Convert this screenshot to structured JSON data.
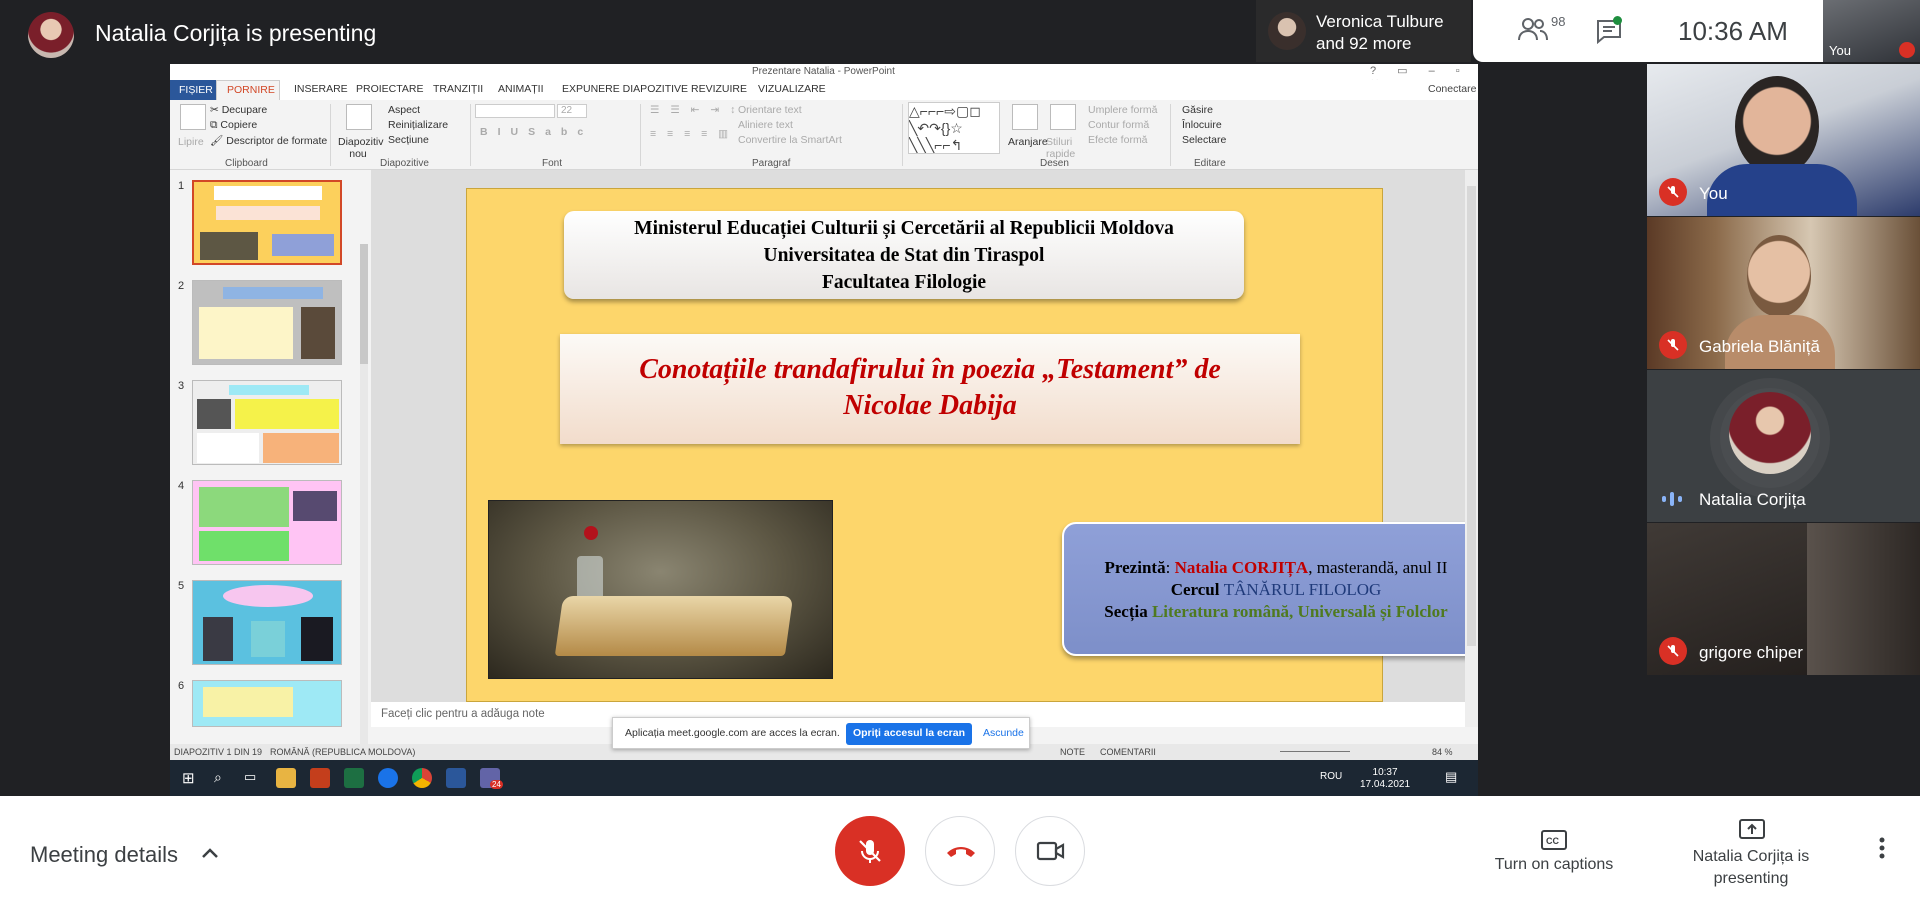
{
  "meet": {
    "presenting_title": "Natalia Corjița is presenting",
    "viewers": "Veronica Tulbure and 92 more",
    "participant_count": "98",
    "clock": "10:36  AM",
    "self_thumb_label": "You",
    "bottom": {
      "meeting_details": "Meeting details",
      "captions": "Turn on captions",
      "presenting": "Natalia Corjița is presenting"
    },
    "tiles": [
      {
        "name": "You",
        "muted": true
      },
      {
        "name": "Gabriela Blăniță",
        "muted": true
      },
      {
        "name": "Natalia Corjița",
        "muted": false,
        "speaking": true
      },
      {
        "name": "grigore chiper",
        "muted": true
      }
    ],
    "colors": {
      "red": "#d93025",
      "blue": "#1a73e8",
      "dark": "#202124"
    }
  },
  "ppt": {
    "window_title": "Prezentare Natalia - PowerPoint",
    "login": "Conectare",
    "tabs": [
      "FIȘIER",
      "PORNIRE",
      "INSERARE",
      "PROIECTARE",
      "TRANZIȚII",
      "ANIMAȚII",
      "EXPUNERE DIAPOZITIVE",
      "REVIZUIRE",
      "VIZUALIZARE"
    ],
    "ribbon": {
      "paste": "Lipire",
      "cut": "Decupare",
      "copy": "Copiere",
      "format_painter": "Descriptor de formate",
      "new_slide": "Diapozitiv nou",
      "layout": "Aspect",
      "reset": "Reinițializare",
      "section": "Secțiune",
      "font_size": "22",
      "text_direction": "Orientare text",
      "align_text": "Aliniere text",
      "smartart": "Convertire la SmartArt",
      "arrange": "Aranjare",
      "quick_styles": "Stiluri rapide",
      "shape_fill": "Umplere formă",
      "shape_outline": "Contur formă",
      "shape_effects": "Efecte formă",
      "find": "Găsire",
      "replace": "Înlocuire",
      "select": "Selectare",
      "groups": {
        "clipboard": "Clipboard",
        "slides": "Diapozitive",
        "font": "Font",
        "paragraph": "Paragraf",
        "drawing": "Desen",
        "editing": "Editare"
      }
    },
    "slide_numbers": [
      "1",
      "2",
      "3",
      "4",
      "5",
      "6"
    ],
    "slide": {
      "header_line1": "Ministerul  Educației  Culturii și Cercetării  al  Republicii Moldova",
      "header_line2": "Universitatea de Stat din Tiraspol",
      "header_line3": "Facultatea Filologie",
      "title_line1": "Conotațiile trandafirului în poezia „Testament” de",
      "title_line2": "Nicolae Dabija",
      "presenter_label": "Prezintă",
      "presenter_name": "Natalia CORJIȚA",
      "presenter_role": ", masterandă, anul II",
      "circle_label": "Cercul",
      "circle_name": "TÂNĂRUL FILOLOG",
      "section_label": "Secția",
      "section_name": "Literatura română, Universală și Folclor"
    },
    "notes_placeholder": "Faceți clic pentru a adăuga note",
    "share_banner": {
      "text": "Aplicația meet.google.com are acces la ecran.",
      "stop": "Opriți accesul la ecran",
      "hide": "Ascunde"
    },
    "status": {
      "slide_of": "DIAPOZITIV 1 DIN 19",
      "language": "ROMÂNĂ (REPUBLICA MOLDOVA)",
      "notes": "NOTE",
      "comments": "COMENTARII",
      "zoom": "84 %"
    },
    "tray": {
      "lang": "ROU",
      "time": "10:37",
      "date": "17.04.2021",
      "badge": "24"
    }
  }
}
